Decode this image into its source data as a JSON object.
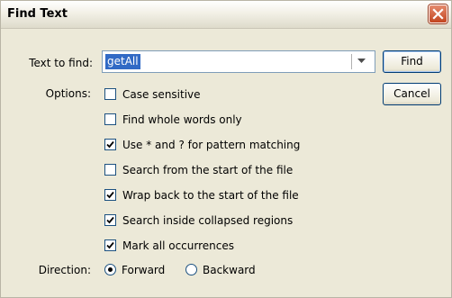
{
  "window": {
    "title": "Find Text"
  },
  "labels": {
    "text_to_find": "Text to find:",
    "options": "Options:",
    "direction": "Direction:"
  },
  "search": {
    "value": "getAll"
  },
  "buttons": {
    "find": "Find",
    "cancel": "Cancel"
  },
  "options": [
    {
      "label": "Case sensitive",
      "checked": false
    },
    {
      "label": "Find whole words only",
      "checked": false
    },
    {
      "label": "Use * and ? for pattern matching",
      "checked": true
    },
    {
      "label": "Search from the start of the file",
      "checked": false
    },
    {
      "label": "Wrap back to the start of the file",
      "checked": true
    },
    {
      "label": "Search inside collapsed regions",
      "checked": true
    },
    {
      "label": "Mark all occurrences",
      "checked": true
    }
  ],
  "direction": {
    "forward": {
      "label": "Forward",
      "selected": true
    },
    "backward": {
      "label": "Backward",
      "selected": false
    }
  },
  "icons": {
    "close": "close-icon",
    "dropdown": "chevron-down-icon",
    "check": "checkmark-icon"
  }
}
